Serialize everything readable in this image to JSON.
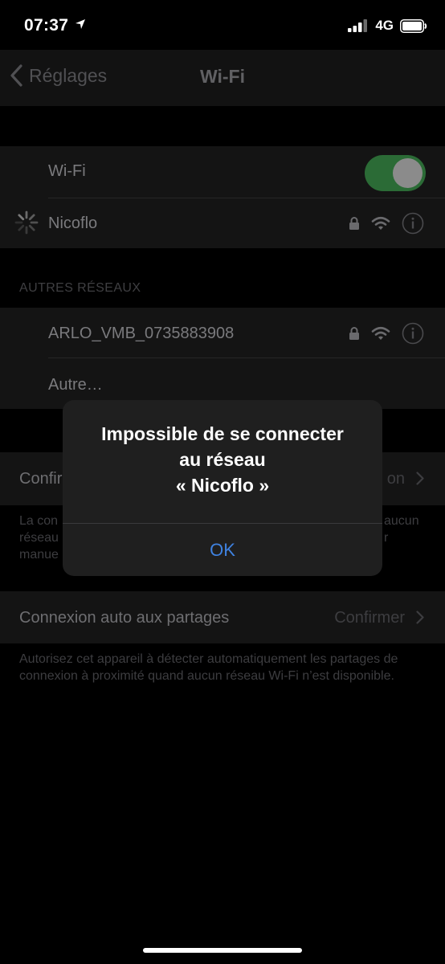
{
  "status_bar": {
    "time": "07:37",
    "network": "4G"
  },
  "nav": {
    "back_label": "Réglages",
    "title": "Wi-Fi"
  },
  "wifi_group": {
    "toggle_label": "Wi-Fi",
    "toggle_on": true,
    "current_network": "Nicoflo"
  },
  "other_networks": {
    "header": "AUTRES RÉSEAUX",
    "items": [
      {
        "name": "ARLO_VMB_0735883908"
      },
      {
        "name": "Autre…"
      }
    ]
  },
  "ask_join": {
    "label": "Confir",
    "value": "on",
    "footnote_lines": [
      "La con",
      "réseau",
      "manue"
    ],
    "footnote_right": [
      "aucun",
      "r"
    ]
  },
  "auto_hotspot": {
    "label": "Connexion auto aux partages",
    "value": "Confirmer",
    "footnote": "Autorisez cet appareil à détecter automatiquement les partages de connexion à proximité quand aucun réseau Wi-Fi n’est disponible."
  },
  "alert": {
    "title_line1": "Impossible de se connecter",
    "title_line2": "au réseau",
    "title_line3": "« Nicoflo »",
    "ok_label": "OK"
  },
  "colors": {
    "toggle_on": "#2b6b36",
    "link_blue": "#3f82e0"
  }
}
